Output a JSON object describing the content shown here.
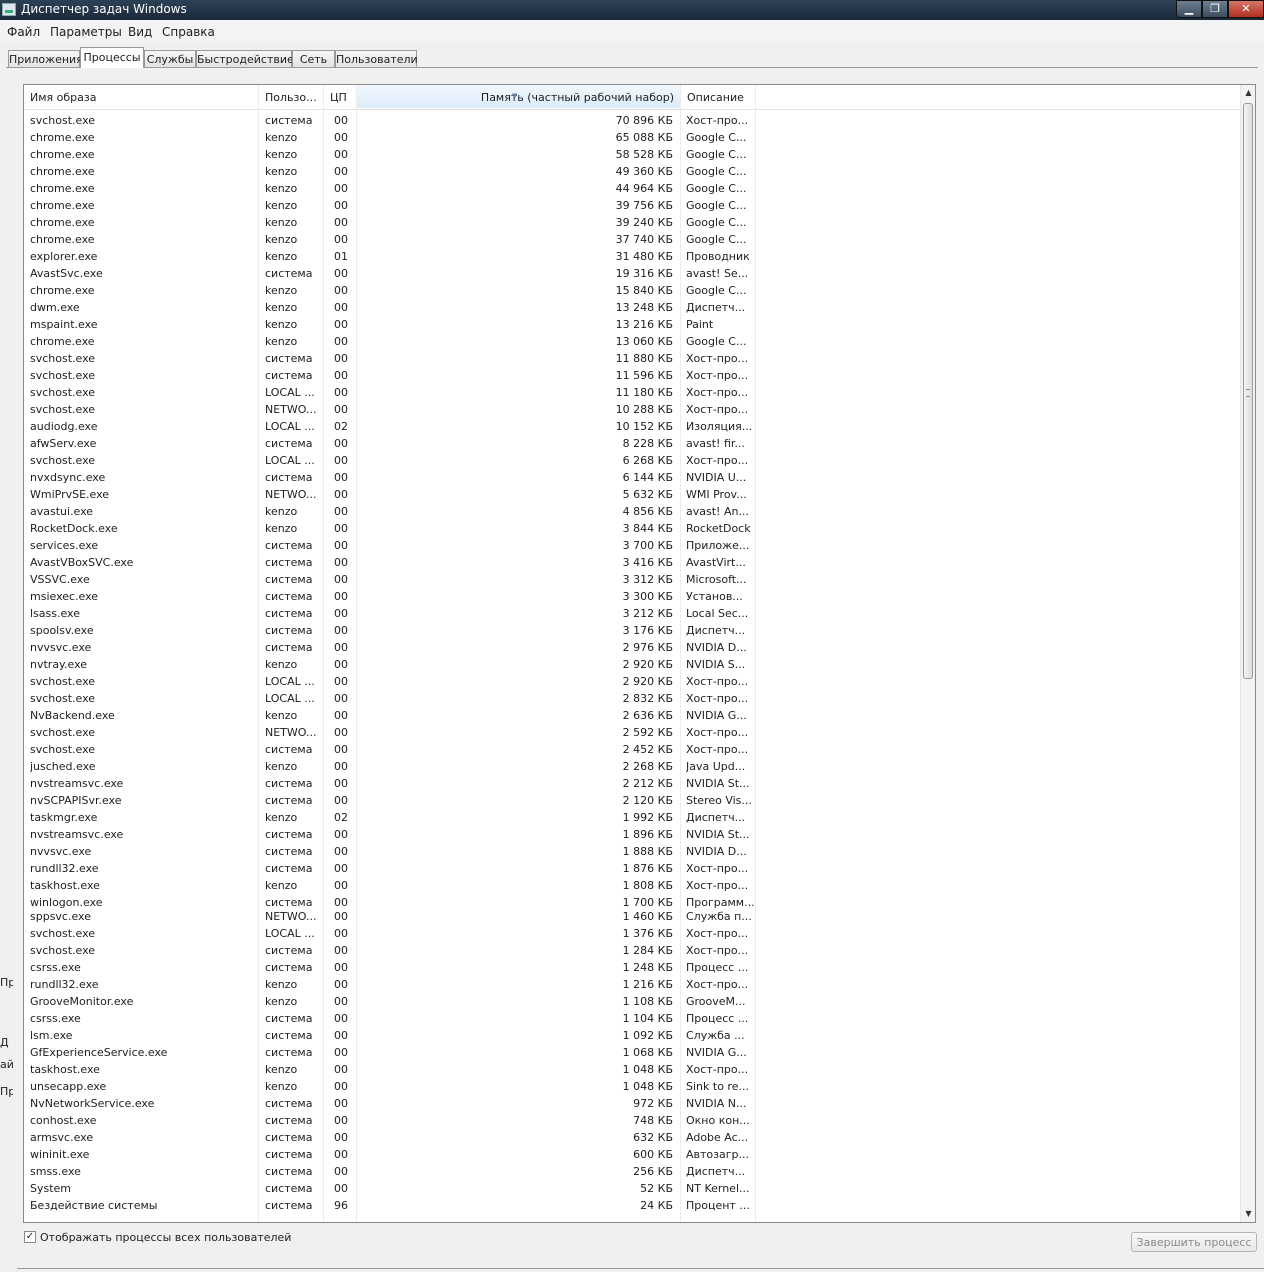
{
  "window": {
    "title": "Диспетчер задач Windows",
    "min_icon": "minimize-icon",
    "max_icon": "maximize-icon",
    "close_icon": "close-icon",
    "min_glyph": "▁",
    "max_glyph": "❐",
    "close_glyph": "✕"
  },
  "menu": [
    "Файл",
    "Параметры",
    "Вид",
    "Справка"
  ],
  "tabs": [
    "Приложения",
    "Процессы",
    "Службы",
    "Быстродействие",
    "Сеть",
    "Пользователи"
  ],
  "active_tab": "Процессы",
  "columns": {
    "name": "Имя образа",
    "user": "Пользо...",
    "cpu": "ЦП",
    "memory": "Память (частный рабочий набор)",
    "description": "Описание"
  },
  "sorted_column": "memory",
  "processes": [
    [
      "svchost.exe",
      "система",
      "00",
      "70 896 КБ",
      "Хост-про..."
    ],
    [
      "chrome.exe",
      "kenzo",
      "00",
      "65 088 КБ",
      "Google C..."
    ],
    [
      "chrome.exe",
      "kenzo",
      "00",
      "58 528 КБ",
      "Google C..."
    ],
    [
      "chrome.exe",
      "kenzo",
      "00",
      "49 360 КБ",
      "Google C..."
    ],
    [
      "chrome.exe",
      "kenzo",
      "00",
      "44 964 КБ",
      "Google C..."
    ],
    [
      "chrome.exe",
      "kenzo",
      "00",
      "39 756 КБ",
      "Google C..."
    ],
    [
      "chrome.exe",
      "kenzo",
      "00",
      "39 240 КБ",
      "Google C..."
    ],
    [
      "chrome.exe",
      "kenzo",
      "00",
      "37 740 КБ",
      "Google C..."
    ],
    [
      "explorer.exe",
      "kenzo",
      "01",
      "31 480 КБ",
      "Проводник"
    ],
    [
      "AvastSvc.exe",
      "система",
      "00",
      "19 316 КБ",
      "avast! Se..."
    ],
    [
      "chrome.exe",
      "kenzo",
      "00",
      "15 840 КБ",
      "Google C..."
    ],
    [
      "dwm.exe",
      "kenzo",
      "00",
      "13 248 КБ",
      "Диспетч..."
    ],
    [
      "mspaint.exe",
      "kenzo",
      "00",
      "13 216 КБ",
      "Paint"
    ],
    [
      "chrome.exe",
      "kenzo",
      "00",
      "13 060 КБ",
      "Google C..."
    ],
    [
      "svchost.exe",
      "система",
      "00",
      "11 880 КБ",
      "Хост-про..."
    ],
    [
      "svchost.exe",
      "система",
      "00",
      "11 596 КБ",
      "Хост-про..."
    ],
    [
      "svchost.exe",
      "LOCAL ...",
      "00",
      "11 180 КБ",
      "Хост-про..."
    ],
    [
      "svchost.exe",
      "NETWO...",
      "00",
      "10 288 КБ",
      "Хост-про..."
    ],
    [
      "audiodg.exe",
      "LOCAL ...",
      "02",
      "10 152 КБ",
      "Изоляция..."
    ],
    [
      "afwServ.exe",
      "система",
      "00",
      "8 228 КБ",
      "avast! fir..."
    ],
    [
      "svchost.exe",
      "LOCAL ...",
      "00",
      "6 268 КБ",
      "Хост-про..."
    ],
    [
      "nvxdsync.exe",
      "система",
      "00",
      "6 144 КБ",
      "NVIDIA U..."
    ],
    [
      "WmiPrvSE.exe",
      "NETWO...",
      "00",
      "5 632 КБ",
      "WMI Prov..."
    ],
    [
      "avastui.exe",
      "kenzo",
      "00",
      "4 856 КБ",
      "avast! An..."
    ],
    [
      "RocketDock.exe",
      "kenzo",
      "00",
      "3 844 КБ",
      "RocketDock"
    ],
    [
      "services.exe",
      "система",
      "00",
      "3 700 КБ",
      "Приложе..."
    ],
    [
      "AvastVBoxSVC.exe",
      "система",
      "00",
      "3 416 КБ",
      "AvastVirt..."
    ],
    [
      "VSSVC.exe",
      "система",
      "00",
      "3 312 КБ",
      "Microsoft..."
    ],
    [
      "msiexec.exe",
      "система",
      "00",
      "3 300 КБ",
      "Установ..."
    ],
    [
      "lsass.exe",
      "система",
      "00",
      "3 212 КБ",
      "Local Sec..."
    ],
    [
      "spoolsv.exe",
      "система",
      "00",
      "3 176 КБ",
      "Диспетч..."
    ],
    [
      "nvvsvc.exe",
      "система",
      "00",
      "2 976 КБ",
      "NVIDIA D..."
    ],
    [
      "nvtray.exe",
      "kenzo",
      "00",
      "2 920 КБ",
      "NVIDIA S..."
    ],
    [
      "svchost.exe",
      "LOCAL ...",
      "00",
      "2 920 КБ",
      "Хост-про..."
    ],
    [
      "svchost.exe",
      "LOCAL ...",
      "00",
      "2 832 КБ",
      "Хост-про..."
    ],
    [
      "NvBackend.exe",
      "kenzo",
      "00",
      "2 636 КБ",
      "NVIDIA G..."
    ],
    [
      "svchost.exe",
      "NETWO...",
      "00",
      "2 592 КБ",
      "Хост-про..."
    ],
    [
      "svchost.exe",
      "система",
      "00",
      "2 452 КБ",
      "Хост-про..."
    ],
    [
      "jusched.exe",
      "kenzo",
      "00",
      "2 268 КБ",
      "Java Upd..."
    ],
    [
      "nvstreamsvc.exe",
      "система",
      "00",
      "2 212 КБ",
      "NVIDIA St..."
    ],
    [
      "nvSCPAPISvr.exe",
      "система",
      "00",
      "2 120 КБ",
      "Stereo Vis..."
    ],
    [
      "taskmgr.exe",
      "kenzo",
      "02",
      "1 992 КБ",
      "Диспетч..."
    ],
    [
      "nvstreamsvc.exe",
      "система",
      "00",
      "1 896 КБ",
      "NVIDIA St..."
    ],
    [
      "nvvsvc.exe",
      "система",
      "00",
      "1 888 КБ",
      "NVIDIA D..."
    ],
    [
      "rundll32.exe",
      "система",
      "00",
      "1 876 КБ",
      "Хост-про..."
    ],
    [
      "taskhost.exe",
      "kenzo",
      "00",
      "1 808 КБ",
      "Хост-про..."
    ],
    [
      "winlogon.exe",
      "система",
      "00",
      "1 700 КБ",
      "Программ..."
    ],
    [
      "sppsvc.exe",
      "NETWO...",
      "00",
      "1 460 КБ",
      "Служба п..."
    ],
    [
      "svchost.exe",
      "LOCAL ...",
      "00",
      "1 376 КБ",
      "Хост-про..."
    ],
    [
      "svchost.exe",
      "система",
      "00",
      "1 284 КБ",
      "Хост-про..."
    ],
    [
      "csrss.exe",
      "система",
      "00",
      "1 248 КБ",
      "Процесс ..."
    ],
    [
      "rundll32.exe",
      "kenzo",
      "00",
      "1 216 КБ",
      "Хост-про..."
    ],
    [
      "GrooveMonitor.exe",
      "kenzo",
      "00",
      "1 108 КБ",
      "GrooveM..."
    ],
    [
      "csrss.exe",
      "система",
      "00",
      "1 104 КБ",
      "Процесс ..."
    ],
    [
      "lsm.exe",
      "система",
      "00",
      "1 092 КБ",
      "Служба ..."
    ],
    [
      "GfExperienceService.exe",
      "система",
      "00",
      "1 068 КБ",
      "NVIDIA G..."
    ],
    [
      "taskhost.exe",
      "kenzo",
      "00",
      "1 048 КБ",
      "Хост-про..."
    ],
    [
      "unsecapp.exe",
      "kenzo",
      "00",
      "1 048 КБ",
      "Sink to re..."
    ],
    [
      "NvNetworkService.exe",
      "система",
      "00",
      "972 КБ",
      "NVIDIA N..."
    ],
    [
      "conhost.exe",
      "система",
      "00",
      "748 КБ",
      "Окно кон..."
    ],
    [
      "armsvc.exe",
      "система",
      "00",
      "632 КБ",
      "Adobe Ac..."
    ],
    [
      "wininit.exe",
      "система",
      "00",
      "600 КБ",
      "Автозагр..."
    ],
    [
      "smss.exe",
      "система",
      "00",
      "256 КБ",
      "Диспетч..."
    ],
    [
      "System",
      "система",
      "00",
      "52 КБ",
      "NT Kernel..."
    ],
    [
      "Бездействие системы",
      "система",
      "96",
      "24 КБ",
      "Процент ..."
    ]
  ],
  "show_all_users": {
    "label": "Отображать процессы всех пользователей",
    "checked": true,
    "check_glyph": "✓"
  },
  "end_process_button": "Завершить процесс",
  "scrollbar": {
    "up_icon": "scroll-up-icon",
    "down_icon": "scroll-down-icon",
    "up_glyph": "▲",
    "down_glyph": "▼"
  },
  "background_fragments": [
    "Пр",
    "Д",
    "ай",
    "Пр"
  ]
}
